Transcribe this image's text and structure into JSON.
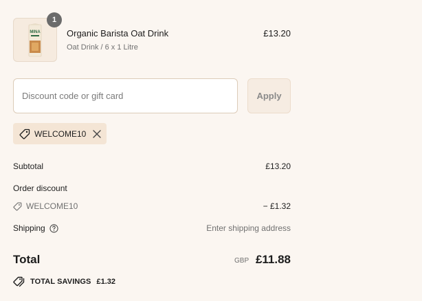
{
  "line_item": {
    "quantity": "1",
    "name": "Organic Barista Oat Drink",
    "variant": "Oat Drink / 6 x 1 Litre",
    "price": "£13.20",
    "thumbnail_brand": "MINA"
  },
  "discount": {
    "placeholder": "Discount code or gift card",
    "value": "",
    "apply_label": "Apply",
    "applied_code": "WELCOME10"
  },
  "summary": {
    "subtotal_label": "Subtotal",
    "subtotal_value": "£13.20",
    "order_discount_label": "Order discount",
    "discount_code": "WELCOME10",
    "discount_value": "− £1.32",
    "shipping_label": "Shipping",
    "shipping_value": "Enter shipping address"
  },
  "total": {
    "label": "Total",
    "currency": "GBP",
    "amount": "£11.88"
  },
  "savings": {
    "label": "TOTAL SAVINGS",
    "amount": "£1.32"
  },
  "icons": [
    "tag-icon",
    "close-icon",
    "help-circle-icon",
    "tags-icon"
  ],
  "colors": {
    "background": "#fbf6f1",
    "chip": "#f4e5d5",
    "badge": "#6b6b6b"
  }
}
